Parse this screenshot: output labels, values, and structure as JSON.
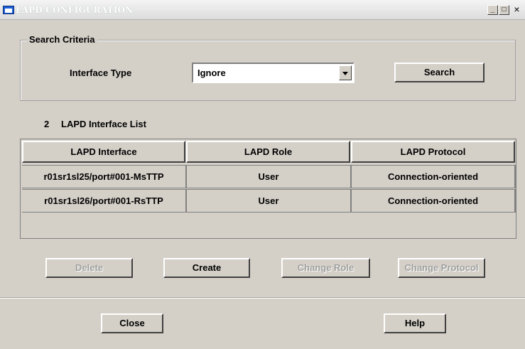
{
  "window": {
    "title": "LAPD CONFIGURATION",
    "min": "_",
    "max": "□",
    "close": "×"
  },
  "search": {
    "group_label": "Search Criteria",
    "interface_type_label": "Interface Type",
    "interface_type_value": "Ignore",
    "search_button": "Search"
  },
  "list": {
    "count": "2",
    "title": "LAPD Interface List",
    "columns": [
      "LAPD Interface",
      "LAPD Role",
      "LAPD Protocol"
    ],
    "rows": [
      [
        "r01sr1sl25/port#001-MsTTP",
        "User",
        "Connection-oriented"
      ],
      [
        "r01sr1sl26/port#001-RsTTP",
        "User",
        "Connection-oriented"
      ]
    ]
  },
  "actions": {
    "delete": "Delete",
    "create": "Create",
    "change_role": "Change Role",
    "change_protocol": "Change Protocol"
  },
  "footer": {
    "close": "Close",
    "help": "Help"
  }
}
